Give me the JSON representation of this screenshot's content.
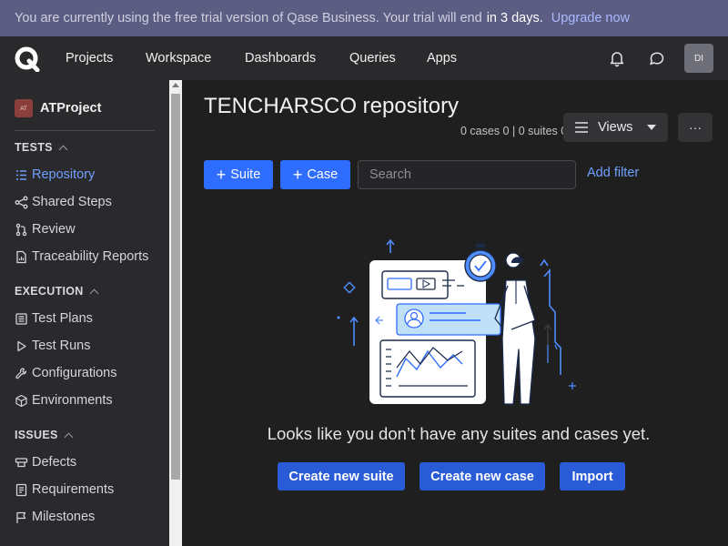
{
  "banner": {
    "text": "You are currently using the free trial version of Qase Business.  Your trial will end",
    "days": "in 3 days.",
    "upgrade": "Upgrade now"
  },
  "nav": {
    "projects": "Projects",
    "workspace": "Workspace",
    "dashboards": "Dashboards",
    "queries": "Queries",
    "apps": "Apps",
    "avatar": "DI"
  },
  "sidebar": {
    "project_badge": "AT",
    "project_name": "ATProject",
    "tests_header": "TESTS",
    "repository": "Repository",
    "shared_steps": "Shared Steps",
    "review": "Review",
    "traceability": "Traceability Reports",
    "execution_header": "EXECUTION",
    "test_plans": "Test Plans",
    "test_runs": "Test Runs",
    "configurations": "Configurations",
    "environments": "Environments",
    "issues_header": "ISSUES",
    "defects": "Defects",
    "requirements": "Requirements",
    "milestones": "Milestones"
  },
  "main": {
    "title": "TENCHARSCO repository",
    "counts": "0 cases 0 | 0 suites 0",
    "views": "Views",
    "more": "···",
    "suite_btn": "Suite",
    "case_btn": "Case",
    "search_placeholder": "Search",
    "add_filter": "Add filter",
    "empty_message": "Looks like you don’t have any suites and cases yet.",
    "create_suite": "Create new suite",
    "create_case": "Create new case",
    "import": "Import"
  },
  "colors": {
    "banner_bg": "#5b5d82",
    "accent_blue": "#2f6dff",
    "action_blue": "#2a5bd6",
    "link_blue": "#6fa0ff",
    "sidebar_bg": "#2a2a2c",
    "main_bg": "#1f1f1f"
  }
}
